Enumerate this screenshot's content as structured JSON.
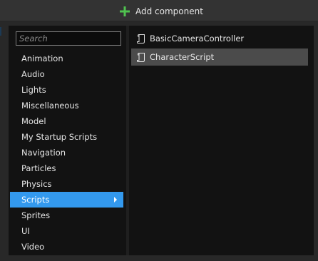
{
  "header": {
    "add_component_label": "Add component",
    "plus_icon": "plus-icon",
    "plus_color": "#4fc24f"
  },
  "search": {
    "placeholder": "Search",
    "value": ""
  },
  "categories": [
    {
      "label": "Animation"
    },
    {
      "label": "Audio"
    },
    {
      "label": "Lights"
    },
    {
      "label": "Miscellaneous"
    },
    {
      "label": "Model"
    },
    {
      "label": "My Startup Scripts"
    },
    {
      "label": "Navigation"
    },
    {
      "label": "Particles"
    },
    {
      "label": "Physics"
    },
    {
      "label": "Scripts",
      "selected": true
    },
    {
      "label": "Sprites"
    },
    {
      "label": "UI"
    },
    {
      "label": "Video"
    }
  ],
  "components": [
    {
      "label": "BasicCameraController",
      "icon": "script-icon"
    },
    {
      "label": "CharacterScript",
      "icon": "script-icon",
      "selected": true
    }
  ],
  "colors": {
    "selection_accent": "#3399ee",
    "selected_component_bg": "#4b4b4b"
  }
}
